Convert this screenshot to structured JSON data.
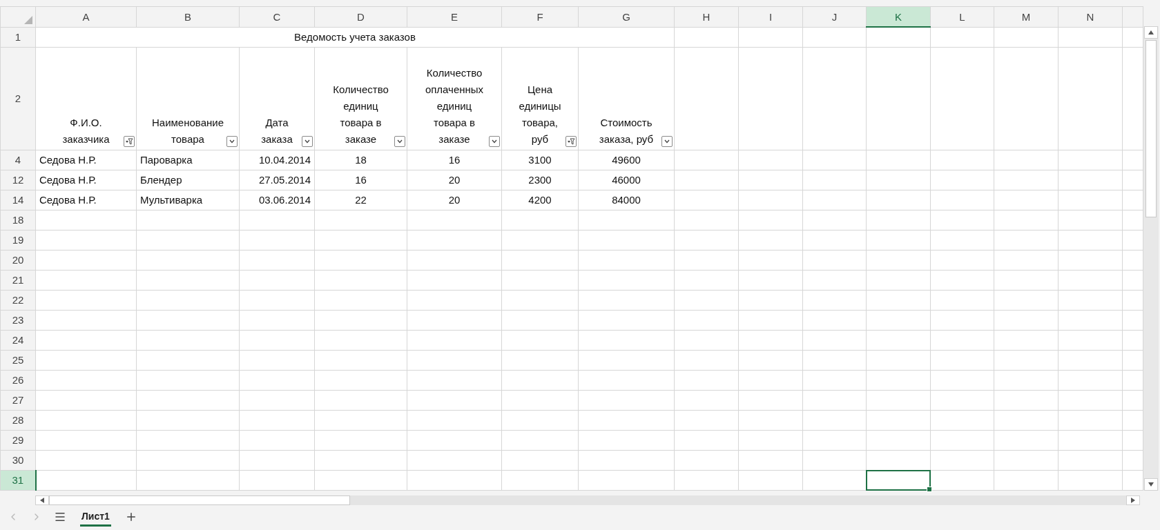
{
  "column_headers": [
    {
      "label": "A",
      "selected": false
    },
    {
      "label": "B",
      "selected": false
    },
    {
      "label": "C",
      "selected": false
    },
    {
      "label": "D",
      "selected": false
    },
    {
      "label": "E",
      "selected": false
    },
    {
      "label": "F",
      "selected": false
    },
    {
      "label": "G",
      "selected": false
    },
    {
      "label": "H",
      "selected": false
    },
    {
      "label": "I",
      "selected": false
    },
    {
      "label": "J",
      "selected": false
    },
    {
      "label": "K",
      "selected": true
    },
    {
      "label": "L",
      "selected": false
    },
    {
      "label": "M",
      "selected": false
    },
    {
      "label": "N",
      "selected": false
    }
  ],
  "title_row": {
    "number": "1",
    "text": "Ведомость учета заказов"
  },
  "header_row": {
    "number": "2",
    "headers": [
      {
        "text": "Ф.И.О.\nзаказчика",
        "filtered": true
      },
      {
        "text": "Наименование\nтовара",
        "filtered": false
      },
      {
        "text": "Дата\nзаказа",
        "filtered": false
      },
      {
        "text": "Количество\nединиц\nтовара в\nзаказе",
        "filtered": false
      },
      {
        "text": "Количество\nоплаченных\nединиц\nтовара в\nзаказе",
        "filtered": false
      },
      {
        "text": "Цена\nединицы\nтовара,\nруб",
        "filtered": true
      },
      {
        "text": "Стоимость\nзаказа, руб",
        "filtered": false
      }
    ]
  },
  "data_rows": [
    {
      "number": "4",
      "selected": false,
      "cells": [
        "Седова Н.Р.",
        "Пароварка",
        "10.04.2014",
        "18",
        "16",
        "3100",
        "49600"
      ]
    },
    {
      "number": "12",
      "selected": false,
      "cells": [
        "Седова Н.Р.",
        "Блендер",
        "27.05.2014",
        "16",
        "20",
        "2300",
        "46000"
      ]
    },
    {
      "number": "14",
      "selected": false,
      "cells": [
        "Седова Н.Р.",
        "Мультиварка",
        "03.06.2014",
        "22",
        "20",
        "4200",
        "84000"
      ]
    }
  ],
  "empty_rows": [
    {
      "number": "18",
      "selected": false
    },
    {
      "number": "19",
      "selected": false
    },
    {
      "number": "20",
      "selected": false
    },
    {
      "number": "21",
      "selected": false
    },
    {
      "number": "22",
      "selected": false
    },
    {
      "number": "23",
      "selected": false
    },
    {
      "number": "24",
      "selected": false
    },
    {
      "number": "25",
      "selected": false
    },
    {
      "number": "26",
      "selected": false
    },
    {
      "number": "27",
      "selected": false
    },
    {
      "number": "28",
      "selected": false
    },
    {
      "number": "29",
      "selected": false
    },
    {
      "number": "30",
      "selected": false
    },
    {
      "number": "31",
      "selected": true
    }
  ],
  "sheet_tabs": [
    {
      "label": "Лист1",
      "selected": true
    }
  ]
}
